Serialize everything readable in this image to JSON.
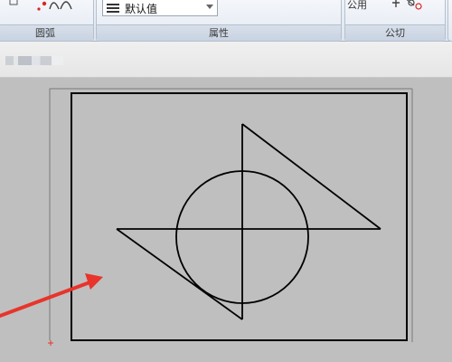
{
  "ribbon": {
    "panels": {
      "arc": {
        "title": "圆弧"
      },
      "properties": {
        "title": "属性",
        "layer_select_value": "默认值"
      },
      "clip": {
        "title": "公切",
        "partial_label": "公用"
      }
    }
  },
  "canvas": {
    "background": "#c0c0c0",
    "line_color": "#000000",
    "arrow_color": "#e8342b"
  },
  "icons": [
    "arc-tools-icon",
    "lines-icon",
    "dropdown-caret-icon",
    "clip-tools-icon",
    "arrow-annotation-icon"
  ]
}
